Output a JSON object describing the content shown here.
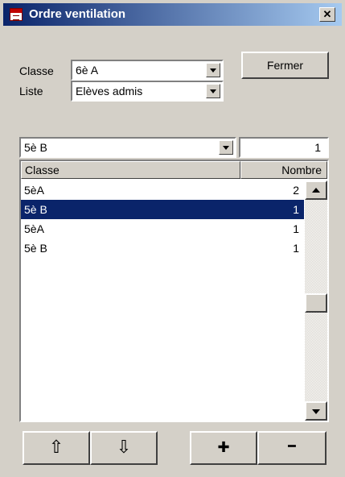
{
  "window": {
    "title": "Ordre ventilation",
    "close_label": "✕"
  },
  "form": {
    "classe_label": "Classe",
    "classe_value": "6è A",
    "liste_label": "Liste",
    "liste_value": "Elèves admis",
    "fermer_label": "Fermer"
  },
  "filter": {
    "class_value": "5è B",
    "number_value": "1"
  },
  "table": {
    "columns": [
      "Classe",
      "Nombre"
    ],
    "rows": [
      {
        "classe": "5èA",
        "nombre": "2"
      },
      {
        "classe": "5è B",
        "nombre": "1"
      },
      {
        "classe": "5èA",
        "nombre": "1"
      },
      {
        "classe": "5è B",
        "nombre": "1"
      }
    ],
    "selected_row_index": 1
  },
  "toolbar": {
    "up_label": "⇧",
    "down_label": "⇩",
    "add_label": "✚",
    "remove_label": "━"
  }
}
